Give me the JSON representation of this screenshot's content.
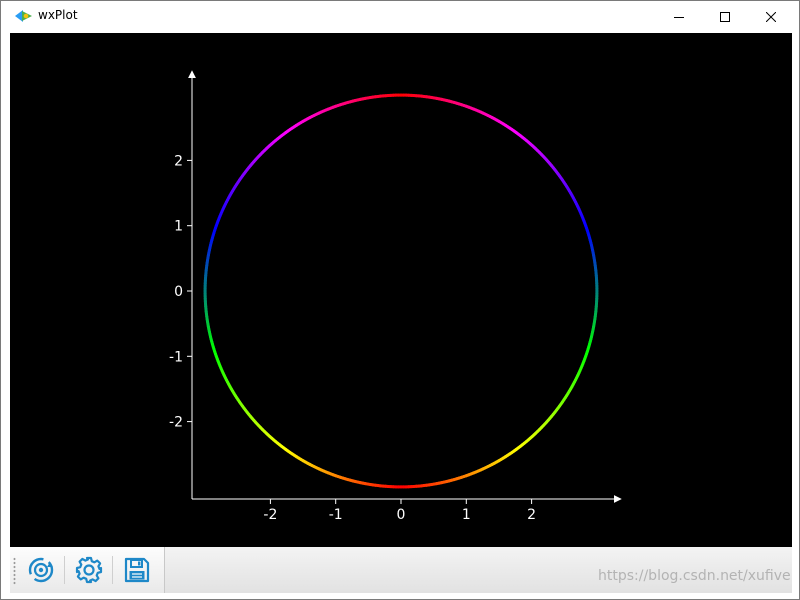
{
  "window": {
    "title": "wxPlot",
    "controls": {
      "minimize": "minimize",
      "maximize": "maximize",
      "close": "close"
    }
  },
  "plot": {
    "background": "#000000",
    "axis_color": "#ffffff",
    "x_ticks": [
      "-2",
      "-1",
      "0",
      "1",
      "2"
    ],
    "y_ticks": [
      "2",
      "1",
      "0",
      "-1",
      "-2"
    ]
  },
  "chart_data": {
    "type": "line",
    "title": "",
    "xlabel": "",
    "ylabel": "",
    "grid": false,
    "xlim": [
      -3.2,
      3.4
    ],
    "ylim": [
      -3.2,
      3.4
    ],
    "series": [
      {
        "shape": "circle",
        "center": [
          0,
          0
        ],
        "radius": 3,
        "color_gradient": [
          "#ff0000",
          "#ff00ff",
          "#0000ff",
          "#00ff00",
          "#ffff00",
          "#ff0000"
        ]
      }
    ]
  },
  "toolbar": {
    "buttons": [
      {
        "icon": "reset-view-icon",
        "color": "#1e88c8"
      },
      {
        "icon": "gear-icon",
        "color": "#1e88c8"
      },
      {
        "icon": "save-icon",
        "color": "#1e88c8"
      }
    ]
  },
  "watermark": "https://blog.csdn.net/xufive"
}
